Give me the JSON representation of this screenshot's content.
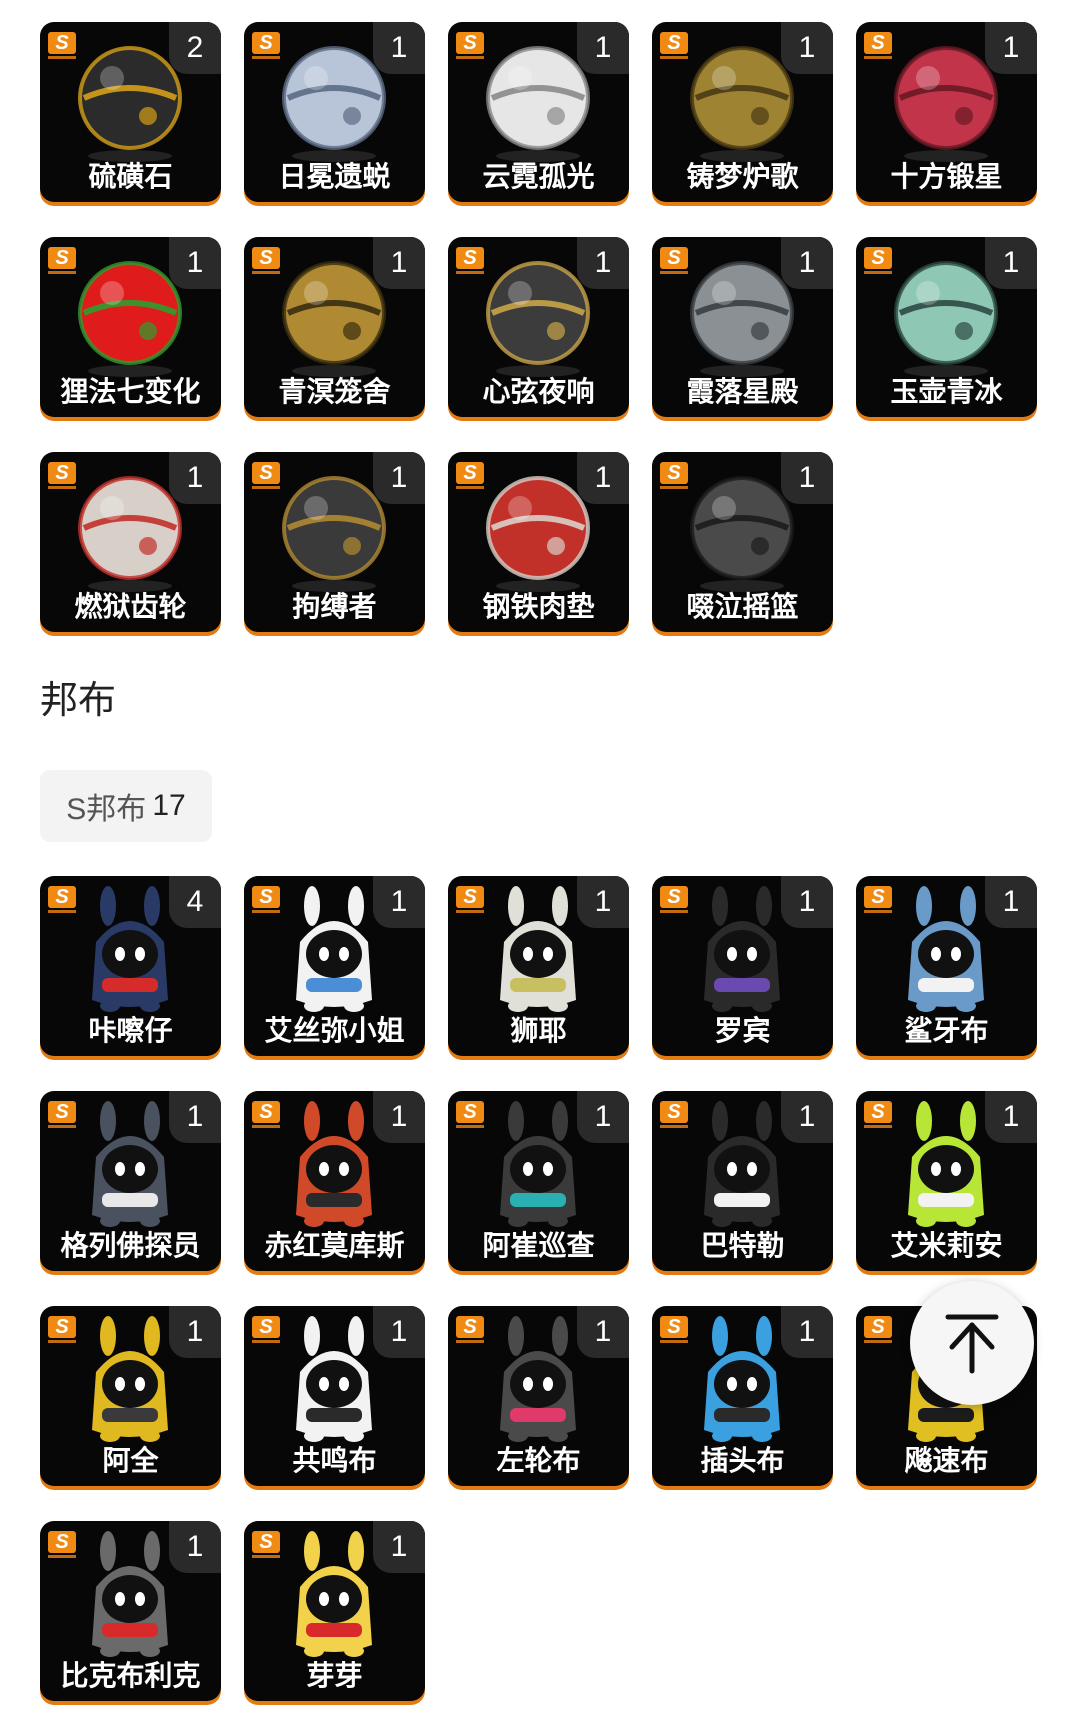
{
  "drive_discs": [
    {
      "name": "硫磺石",
      "count": "2",
      "icon": "sulfur-stone-icon",
      "colors": [
        "#2b2b2b",
        "#d4a017"
      ]
    },
    {
      "name": "日冕遗蜕",
      "count": "1",
      "icon": "corona-relic-icon",
      "colors": [
        "#b8c4d8",
        "#5c6b85"
      ]
    },
    {
      "name": "云霓孤光",
      "count": "1",
      "icon": "crystal-orb-icon",
      "colors": [
        "#e6e6e6",
        "#8a8a8a"
      ]
    },
    {
      "name": "铸梦炉歌",
      "count": "1",
      "icon": "golden-lantern-icon",
      "colors": [
        "#9e8332",
        "#4a3b14"
      ]
    },
    {
      "name": "十方锻星",
      "count": "1",
      "icon": "red-orb-icon",
      "colors": [
        "#c2344a",
        "#6a1a24"
      ]
    },
    {
      "name": "狸法七变化",
      "count": "1",
      "icon": "red-apple-icon",
      "colors": [
        "#e01b1b",
        "#2e9e2e"
      ]
    },
    {
      "name": "青溟笼舍",
      "count": "1",
      "icon": "bird-cage-icon",
      "colors": [
        "#b08a32",
        "#3a2e10"
      ]
    },
    {
      "name": "心弦夜响",
      "count": "1",
      "icon": "night-orb-icon",
      "colors": [
        "#3c3c3c",
        "#c8a448"
      ]
    },
    {
      "name": "霞落星殿",
      "count": "1",
      "icon": "pavilion-icon",
      "colors": [
        "#8a9094",
        "#3a3f44"
      ]
    },
    {
      "name": "玉壶青冰",
      "count": "1",
      "icon": "jade-pot-icon",
      "colors": [
        "#8fc7b5",
        "#2c4a44"
      ]
    },
    {
      "name": "燃狱齿轮",
      "count": "1",
      "icon": "star-gear-orb-icon",
      "colors": [
        "#d8d0c8",
        "#c2302a"
      ]
    },
    {
      "name": "拘缚者",
      "count": "1",
      "icon": "chained-orb-icon",
      "colors": [
        "#3a3a3a",
        "#b08a32"
      ]
    },
    {
      "name": "钢铁肉垫",
      "count": "1",
      "icon": "fist-orb-icon",
      "colors": [
        "#c2302a",
        "#d8d0c8"
      ]
    },
    {
      "name": "啜泣摇篮",
      "count": "1",
      "icon": "spiked-orb-icon",
      "colors": [
        "#4a4a4a",
        "#1c1c1c"
      ]
    }
  ],
  "section": {
    "title": "邦布"
  },
  "filter": {
    "label": "S邦布",
    "count": "17"
  },
  "bangboos": [
    {
      "name": "咔嚓仔",
      "count": "4",
      "icon": "bangboo-red-cap-icon",
      "colors": [
        "#2a3a66",
        "#d62b2b"
      ]
    },
    {
      "name": "艾丝弥小姐",
      "count": "1",
      "icon": "bangboo-maid-icon",
      "colors": [
        "#f2f2f2",
        "#4a8ed6"
      ]
    },
    {
      "name": "狮耶",
      "count": "1",
      "icon": "bangboo-lion-icon",
      "colors": [
        "#e0e0d8",
        "#c8c060"
      ]
    },
    {
      "name": "罗宾",
      "count": "1",
      "icon": "bangboo-robin-icon",
      "colors": [
        "#2a2a2a",
        "#6a4ab0"
      ]
    },
    {
      "name": "鲨牙布",
      "count": "1",
      "icon": "bangboo-shark-icon",
      "colors": [
        "#6a9ac8",
        "#f2f2f2"
      ]
    },
    {
      "name": "格列佛探员",
      "count": "1",
      "icon": "bangboo-agent-icon",
      "colors": [
        "#4a5260",
        "#e8e8e8"
      ]
    },
    {
      "name": "赤红莫库斯",
      "count": "1",
      "icon": "bangboo-carrot-icon",
      "colors": [
        "#d04a2a",
        "#2a2a2a"
      ]
    },
    {
      "name": "阿崔巡查",
      "count": "1",
      "icon": "bangboo-patrol-icon",
      "colors": [
        "#3a3a3a",
        "#2ab0b0"
      ]
    },
    {
      "name": "巴特勒",
      "count": "1",
      "icon": "bangboo-butler-icon",
      "colors": [
        "#2a2a2a",
        "#f2f2f2"
      ]
    },
    {
      "name": "艾米莉安",
      "count": "1",
      "icon": "bangboo-neon-icon",
      "colors": [
        "#b8e636",
        "#f2f2f2"
      ]
    },
    {
      "name": "阿全",
      "count": "1",
      "icon": "bangboo-hardhat-icon",
      "colors": [
        "#e0b820",
        "#3a3a3a"
      ]
    },
    {
      "name": "共鸣布",
      "count": "1",
      "icon": "bangboo-speaker-icon",
      "colors": [
        "#f2f2f2",
        "#2a2a2a"
      ]
    },
    {
      "name": "左轮布",
      "count": "1",
      "icon": "bangboo-revolver-icon",
      "colors": [
        "#4a4a4a",
        "#e03a6a"
      ]
    },
    {
      "name": "插头布",
      "count": "1",
      "icon": "bangboo-plug-icon",
      "colors": [
        "#3aa0e0",
        "#2a2a2a"
      ]
    },
    {
      "name": "飚速布",
      "count": "",
      "icon": "bangboo-racer-icon",
      "colors": [
        "#e0c020",
        "#1c1c1c"
      ]
    },
    {
      "name": "比克布利克",
      "count": "1",
      "icon": "bangboo-bickbrick-icon",
      "colors": [
        "#6a6a6a",
        "#d82a2a"
      ]
    },
    {
      "name": "芽芽",
      "count": "1",
      "icon": "bangboo-sprout-icon",
      "colors": [
        "#f2d24a",
        "#d82a2a"
      ]
    }
  ],
  "scroll_top": {
    "icon": "arrow-up-to-top-icon"
  },
  "badge": {
    "rank": "S"
  }
}
